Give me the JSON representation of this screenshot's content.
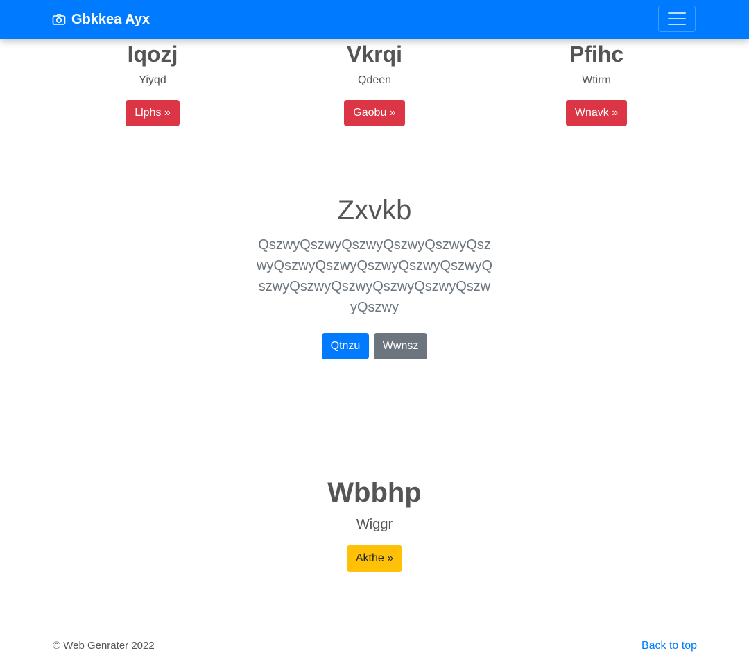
{
  "navbar": {
    "brand_icon": "camera-icon",
    "brand": "Gbkkea Ayx",
    "toggler_icon": "hamburger-menu-icon",
    "color": "#007bff"
  },
  "columns": [
    {
      "title": "Iqozj",
      "text": "Yiyqd",
      "button": "Llphs »"
    },
    {
      "title": "Vkrqi",
      "text": "Qdeen",
      "button": "Gaobu »"
    },
    {
      "title": "Pfihc",
      "text": "Wtirm",
      "button": "Wnavk »"
    }
  ],
  "hero": {
    "title": "Zxvkb",
    "lead": "QszwyQszwyQszwyQszwyQszwyQszwyQszwyQszwyQszwyQszwyQszwyQszwyQszwyQszwyQszwyQszwyQszwyQszwy",
    "primary_button": "Qtnzu",
    "secondary_button": "Wwnsz"
  },
  "feature": {
    "title": "Wbbhp",
    "text": "Wiggr",
    "button": "Akthe »"
  },
  "footer": {
    "copyright": "© Web Genrater 2022",
    "back_to_top": "Back to top"
  },
  "colors": {
    "primary": "#007bff",
    "danger": "#dc3545",
    "secondary": "#6c757d",
    "warning": "#ffc107"
  }
}
